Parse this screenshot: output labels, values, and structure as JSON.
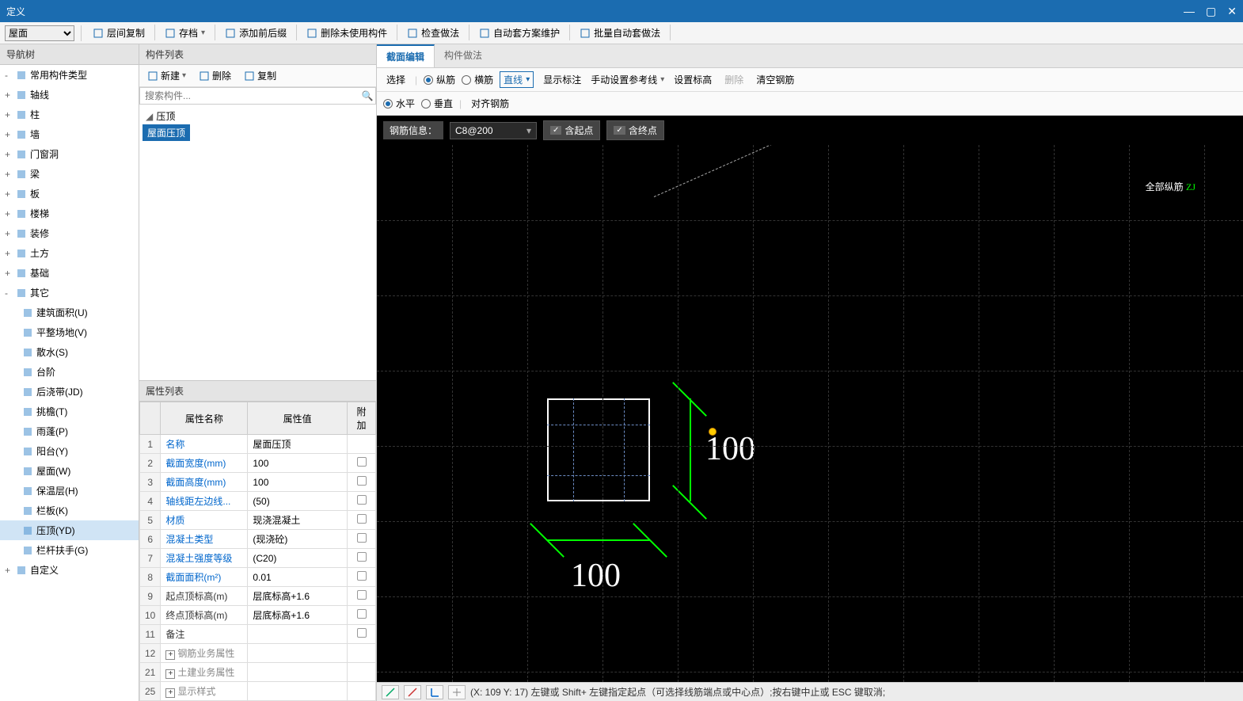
{
  "window": {
    "title": "定义"
  },
  "toolbar": {
    "floor_select": "屋面",
    "btns": [
      {
        "label": "层间复制",
        "icon": "copy-between-floors-icon"
      },
      {
        "label": "存档",
        "icon": "archive-icon",
        "dd": true
      },
      {
        "label": "添加前后缀",
        "icon": "prefix-suffix-icon"
      },
      {
        "label": "删除未使用构件",
        "icon": "delete-unused-icon"
      },
      {
        "label": "检查做法",
        "icon": "check-method-icon"
      },
      {
        "label": "自动套方案维护",
        "icon": "auto-scheme-icon"
      },
      {
        "label": "批量自动套做法",
        "icon": "batch-auto-icon"
      }
    ]
  },
  "nav": {
    "header": "导航树",
    "items": [
      {
        "label": "常用构件类型",
        "indent": 0,
        "exp": "-",
        "icon": "star-icon"
      },
      {
        "label": "轴线",
        "indent": 0,
        "exp": "+",
        "icon": "axis-icon"
      },
      {
        "label": "柱",
        "indent": 0,
        "exp": "+",
        "icon": "column-icon"
      },
      {
        "label": "墙",
        "indent": 0,
        "exp": "+",
        "icon": "wall-icon"
      },
      {
        "label": "门窗洞",
        "indent": 0,
        "exp": "+",
        "icon": "opening-icon"
      },
      {
        "label": "梁",
        "indent": 0,
        "exp": "+",
        "icon": "beam-icon"
      },
      {
        "label": "板",
        "indent": 0,
        "exp": "+",
        "icon": "slab-icon"
      },
      {
        "label": "楼梯",
        "indent": 0,
        "exp": "+",
        "icon": "stair-icon"
      },
      {
        "label": "装修",
        "indent": 0,
        "exp": "+",
        "icon": "decor-icon"
      },
      {
        "label": "土方",
        "indent": 0,
        "exp": "+",
        "icon": "earth-icon"
      },
      {
        "label": "基础",
        "indent": 0,
        "exp": "+",
        "icon": "foundation-icon"
      },
      {
        "label": "其它",
        "indent": 0,
        "exp": "-",
        "icon": "other-icon"
      },
      {
        "label": "建筑面积(U)",
        "indent": 1,
        "icon": "area-icon"
      },
      {
        "label": "平整场地(V)",
        "indent": 1,
        "icon": "level-icon"
      },
      {
        "label": "散水(S)",
        "indent": 1,
        "icon": "apron-icon"
      },
      {
        "label": "台阶",
        "indent": 1,
        "icon": "step-icon"
      },
      {
        "label": "后浇带(JD)",
        "indent": 1,
        "icon": "postpour-icon"
      },
      {
        "label": "挑檐(T)",
        "indent": 1,
        "icon": "eave-icon"
      },
      {
        "label": "雨蓬(P)",
        "indent": 1,
        "icon": "canopy-icon"
      },
      {
        "label": "阳台(Y)",
        "indent": 1,
        "icon": "balcony-icon"
      },
      {
        "label": "屋面(W)",
        "indent": 1,
        "icon": "roof-icon"
      },
      {
        "label": "保温层(H)",
        "indent": 1,
        "icon": "insulation-icon"
      },
      {
        "label": "栏板(K)",
        "indent": 1,
        "icon": "parapet-icon"
      },
      {
        "label": "压顶(YD)",
        "indent": 1,
        "icon": "coping-icon",
        "selected": true
      },
      {
        "label": "栏杆扶手(G)",
        "indent": 1,
        "icon": "handrail-icon"
      },
      {
        "label": "自定义",
        "indent": 0,
        "exp": "+",
        "icon": "custom-icon"
      }
    ]
  },
  "comp": {
    "header": "构件列表",
    "tbtns": [
      {
        "label": "新建",
        "icon": "new-icon",
        "dd": true
      },
      {
        "label": "删除",
        "icon": "delete-icon"
      },
      {
        "label": "复制",
        "icon": "copy-icon"
      }
    ],
    "search_placeholder": "搜索构件...",
    "tree": [
      {
        "label": "压顶",
        "caret": "◢",
        "indent": 0
      },
      {
        "label": "屋面压顶",
        "indent": 1,
        "selected": true
      }
    ]
  },
  "props": {
    "header": "属性列表",
    "cols": {
      "name": "属性名称",
      "value": "属性值",
      "attach": "附加"
    },
    "rows": [
      {
        "idx": "1",
        "name": "名称",
        "value": "屋面压顶",
        "link": true
      },
      {
        "idx": "2",
        "name": "截面宽度(mm)",
        "value": "100",
        "link": true,
        "chk": true
      },
      {
        "idx": "3",
        "name": "截面高度(mm)",
        "value": "100",
        "link": true,
        "chk": true
      },
      {
        "idx": "4",
        "name": "轴线距左边线...",
        "value": "(50)",
        "link": true,
        "chk": true
      },
      {
        "idx": "5",
        "name": "材质",
        "value": "现浇混凝土",
        "link": true,
        "chk": true
      },
      {
        "idx": "6",
        "name": "混凝土类型",
        "value": "(现浇砼)",
        "link": true,
        "chk": true
      },
      {
        "idx": "7",
        "name": "混凝土强度等级",
        "value": "(C20)",
        "link": true,
        "chk": true
      },
      {
        "idx": "8",
        "name": "截面面积(m²)",
        "value": "0.01",
        "link": true,
        "chk": true
      },
      {
        "idx": "9",
        "name": "起点顶标高(m)",
        "value": "层底标高+1.6",
        "chk": true
      },
      {
        "idx": "10",
        "name": "终点顶标高(m)",
        "value": "层底标高+1.6",
        "chk": true
      },
      {
        "idx": "11",
        "name": "备注",
        "value": "",
        "chk": true
      },
      {
        "idx": "12",
        "name": "钢筋业务属性",
        "value": "",
        "expand": true
      },
      {
        "idx": "21",
        "name": "土建业务属性",
        "value": "",
        "expand": true
      },
      {
        "idx": "25",
        "name": "显示样式",
        "value": "",
        "expand": true
      }
    ]
  },
  "editor": {
    "tabs": [
      {
        "label": "截面编辑",
        "active": true
      },
      {
        "label": "构件做法"
      }
    ],
    "tb1": {
      "select": "选择",
      "r_vert": "纵筋",
      "r_horiz": "横筋",
      "line_combo": "直线",
      "show_dim": "显示标注",
      "manual_ref": "手动设置参考线",
      "set_elev": "设置标高",
      "delete": "删除",
      "clear": "清空钢筋"
    },
    "tb2": {
      "r_h": "水平",
      "r_v": "垂直",
      "align": "对齐钢筋"
    },
    "rebar_info": {
      "label": "钢筋信息：",
      "value": "C8@200",
      "chk_start": "含起点",
      "chk_end": "含终点"
    },
    "title": {
      "white": "全部纵筋 ",
      "green": "ZJ"
    },
    "dim_x": "100",
    "dim_y": "100"
  },
  "status": {
    "text": "(X: 109 Y: 17)  左键或 Shift+ 左键指定起点（可选择线筋端点或中心点）;按右键中止或 ESC 键取消;"
  }
}
